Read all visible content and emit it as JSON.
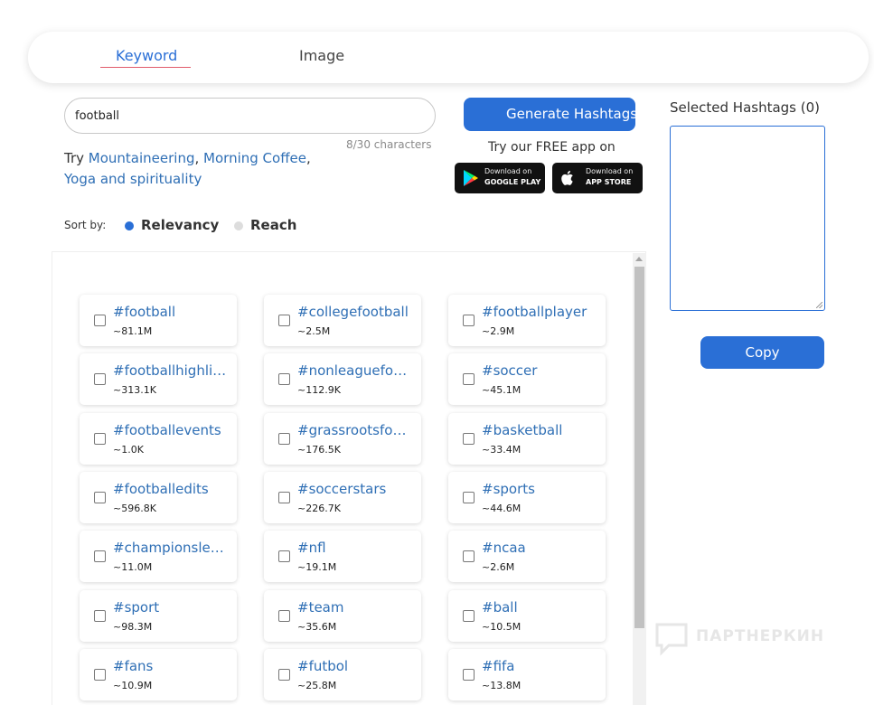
{
  "tabs": {
    "keyword": "Keyword",
    "image": "Image"
  },
  "search": {
    "value": "football",
    "char_count": "8/30 characters"
  },
  "suggestions": {
    "prefix": "Try",
    "items": [
      "Mountaineering",
      "Morning Coffee",
      "Yoga and spirituality"
    ]
  },
  "generate_label": "Generate Hashtags",
  "app_promo": {
    "text": "Try our FREE app on",
    "google_play": {
      "small": "Download on",
      "big": "GOOGLE PLAY"
    },
    "app_store": {
      "small": "Download on",
      "big": "APP STORE"
    }
  },
  "sort": {
    "label": "Sort by:",
    "options": [
      "Relevancy",
      "Reach"
    ],
    "selected": "Relevancy"
  },
  "hashtags": [
    {
      "name": "#football",
      "count": "~81.1M"
    },
    {
      "name": "#collegefootball",
      "count": "~2.5M"
    },
    {
      "name": "#footballplayer",
      "count": "~2.9M"
    },
    {
      "name": "#footballhighlights",
      "count": "~313.1K"
    },
    {
      "name": "#nonleaguefootball",
      "count": "~112.9K"
    },
    {
      "name": "#soccer",
      "count": "~45.1M"
    },
    {
      "name": "#footballevents",
      "count": "~1.0K"
    },
    {
      "name": "#grassrootsfootball",
      "count": "~176.5K"
    },
    {
      "name": "#basketball",
      "count": "~33.4M"
    },
    {
      "name": "#footballedits",
      "count": "~596.8K"
    },
    {
      "name": "#soccerstars",
      "count": "~226.7K"
    },
    {
      "name": "#sports",
      "count": "~44.6M"
    },
    {
      "name": "#championsleague",
      "count": "~11.0M"
    },
    {
      "name": "#nfl",
      "count": "~19.1M"
    },
    {
      "name": "#ncaa",
      "count": "~2.6M"
    },
    {
      "name": "#sport",
      "count": "~98.3M"
    },
    {
      "name": "#team",
      "count": "~35.6M"
    },
    {
      "name": "#ball",
      "count": "~10.5M"
    },
    {
      "name": "#fans",
      "count": "~10.9M"
    },
    {
      "name": "#futbol",
      "count": "~25.8M"
    },
    {
      "name": "#fifa",
      "count": "~13.8M"
    }
  ],
  "selected": {
    "title": "Selected Hashtags (0)",
    "copy_label": "Copy"
  },
  "watermark": "ПАРТНЕРКИН",
  "colors": {
    "accent": "#2a6fd6",
    "link": "#2f6fb5"
  }
}
